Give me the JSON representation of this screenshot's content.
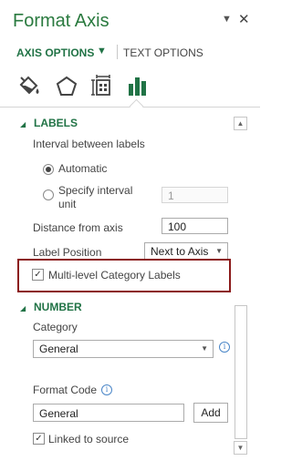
{
  "pane": {
    "title": "Format Axis",
    "menu_glyph": "▼",
    "close_glyph": "✕"
  },
  "tabs": {
    "axis_options": "AXIS OPTIONS",
    "axis_options_dd": "▼",
    "text_options": "TEXT OPTIONS"
  },
  "icons": [
    "fill-line-icon",
    "effects-pentagon-icon",
    "size-properties-icon",
    "axis-options-bar-icon"
  ],
  "labels_section": {
    "title": "LABELS",
    "interval_between_labels": "Interval between labels",
    "automatic": "Automatic",
    "specify_interval_line1": "Specify interval",
    "specify_interval_line2": "unit",
    "specify_interval_value": "1",
    "distance_from_axis_label": "Distance from axis",
    "distance_from_axis_value": "100",
    "label_position_label": "Label Position",
    "label_position_value": "Next to Axis",
    "multi_level_label": "Multi-level Category Labels",
    "multi_level_checked": true
  },
  "number_section": {
    "title": "NUMBER",
    "category_label": "Category",
    "category_value": "General",
    "format_code_label": "Format Code",
    "format_code_value": "General",
    "add_button": "Add",
    "linked_to_source": "Linked to source",
    "linked_checked": true
  },
  "colors": {
    "accent": "#217346",
    "highlight_border": "#8b1a1a",
    "info": "#4a86c8"
  }
}
